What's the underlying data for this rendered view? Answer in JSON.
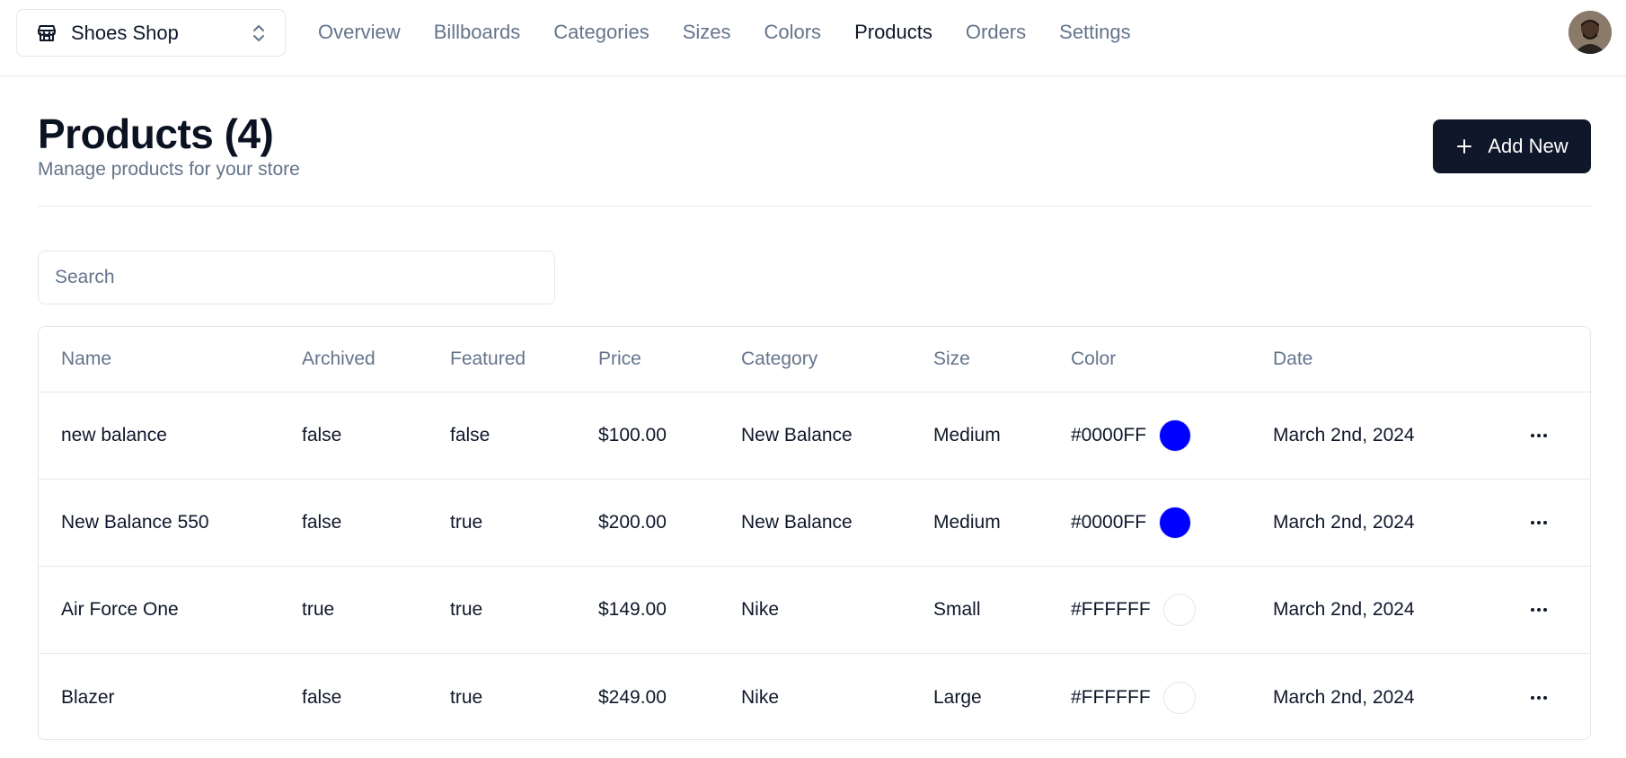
{
  "store": {
    "name": "Shoes Shop",
    "icon": "store-icon"
  },
  "nav": [
    {
      "label": "Overview",
      "active": false
    },
    {
      "label": "Billboards",
      "active": false
    },
    {
      "label": "Categories",
      "active": false
    },
    {
      "label": "Sizes",
      "active": false
    },
    {
      "label": "Colors",
      "active": false
    },
    {
      "label": "Products",
      "active": true
    },
    {
      "label": "Orders",
      "active": false
    },
    {
      "label": "Settings",
      "active": false
    }
  ],
  "header": {
    "title": "Products (4)",
    "subtitle": "Manage products for your store",
    "add_label": "Add New"
  },
  "search": {
    "placeholder": "Search",
    "value": ""
  },
  "table": {
    "columns": [
      "Name",
      "Archived",
      "Featured",
      "Price",
      "Category",
      "Size",
      "Color",
      "Date"
    ],
    "rows": [
      {
        "name": "new balance",
        "archived": "false",
        "featured": "false",
        "price": "$100.00",
        "category": "New Balance",
        "size": "Medium",
        "color": "#0000FF",
        "date": "March 2nd, 2024"
      },
      {
        "name": "New Balance 550",
        "archived": "false",
        "featured": "true",
        "price": "$200.00",
        "category": "New Balance",
        "size": "Medium",
        "color": "#0000FF",
        "date": "March 2nd, 2024"
      },
      {
        "name": "Air Force One",
        "archived": "true",
        "featured": "true",
        "price": "$149.00",
        "category": "Nike",
        "size": "Small",
        "color": "#FFFFFF",
        "date": "March 2nd, 2024"
      },
      {
        "name": "Blazer",
        "archived": "false",
        "featured": "true",
        "price": "$249.00",
        "category": "Nike",
        "size": "Large",
        "color": "#FFFFFF",
        "date": "March 2nd, 2024"
      }
    ]
  },
  "colors": {
    "primary": "#0f172a",
    "muted": "#64748b",
    "border": "#e2e8f0"
  }
}
